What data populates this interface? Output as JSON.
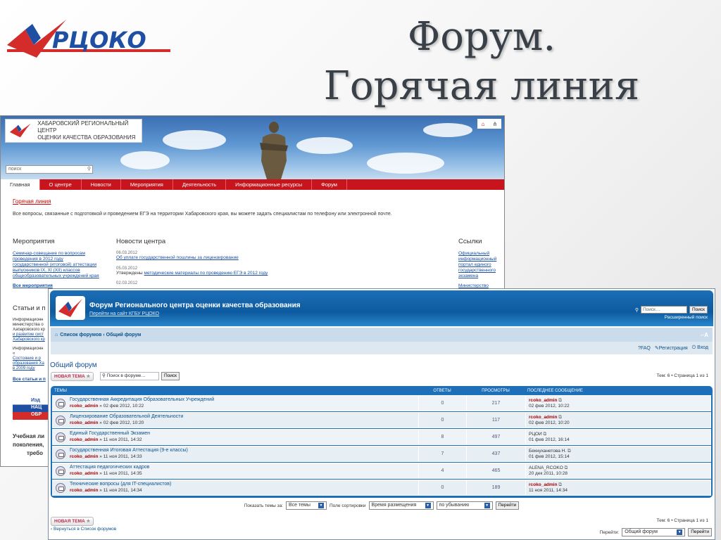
{
  "slide": {
    "title_line1": "Форум.",
    "title_line2": "Горячая линия",
    "logo_text": "РЦОКО",
    "brand_colors": {
      "red": "#d42b2b",
      "blue": "#1f4fa3"
    }
  },
  "site": {
    "logo_line1": "ХАБАРОВСКИЙ РЕГИОНАЛЬНЫЙ ЦЕНТР",
    "logo_line2": "ОЦЕНКИ КАЧЕСТВА ОБРАЗОВАНИЯ",
    "search_placeholder": "поиск",
    "nav": [
      "Главная",
      "О центре",
      "Новости",
      "Мероприятия",
      "Деятельность",
      "Информационные ресурсы",
      "Форум"
    ],
    "hotline_link": "Горячая линия",
    "intro": "Все вопросы, связанные с подготовкой и проведением ЕГЭ на территории Хабаровского края, вы можете задать специалистам по телефону или электронной почте.",
    "events": {
      "heading": "Мероприятия",
      "link_lines": [
        "Семинар-совещание по вопросам",
        "проведения в 2012 году",
        "государственной (итоговой) аттестации",
        "выпускников IX, XI (XII) классов",
        "общеобразовательных учреждений края"
      ],
      "all_link": "Все мероприятия"
    },
    "news": {
      "heading": "Новости центра",
      "items": [
        {
          "date": "06.03.2012",
          "text": "Об уплате государственной пошлины за лицензирование"
        },
        {
          "date": "05.03.2012",
          "prefix": "Утверждены ",
          "text": "методические материалы по проведению ЕГЭ в 2012 году"
        },
        {
          "date": "02.03.2012",
          "text": ""
        }
      ]
    },
    "links": {
      "heading": "Ссылки",
      "link_lines": [
        "Официальный",
        "информационный",
        "портал единого",
        "государственного",
        "экзамена"
      ],
      "next": "Министерство"
    },
    "articles": {
      "heading": "Статьи и п",
      "text1": [
        "Информационн",
        "министерства о",
        "Хабаровского кр"
      ],
      "links1": [
        "и развитие сист",
        "Хабаровского кр"
      ],
      "text2": [
        "Информационн",
        "«"
      ],
      "links2": [
        "Состояние и р",
        "образования Ха",
        "в 2009 году"
      ],
      "all": "Все статьи и п"
    },
    "ad": {
      "lines": [
        "Изд",
        "НАЦ",
        "ОБР"
      ],
      "caption": [
        "Учебная ли",
        "поколения,",
        "требо"
      ]
    }
  },
  "forum": {
    "title": "Форум Регионального центра оценки качества образования",
    "subtitle": "Перейти на сайт КГБУ РЦОКО",
    "search_placeholder": "Поиск…",
    "search_btn": "Поиск",
    "advanced_search": "Расширенный поиск",
    "breadcrumb_root": "Список форумов",
    "breadcrumb_sep": " ‹ ",
    "breadcrumb_current": "Общий форум",
    "fontsize": "-·A",
    "user_links": {
      "faq": "FAQ",
      "register": "Регистрация",
      "login": "Вход"
    },
    "heading": "Общий форум",
    "new_topic": "НОВАЯ ТЕМА",
    "forum_search_placeholder": "Поиск в форуме…",
    "forum_search_btn": "Поиск",
    "pagination": "Тем: 6 • Страница 1 из 1",
    "columns": {
      "topics": "ТЕМЫ",
      "replies": "ОТВЕТЫ",
      "views": "ПРОСМОТРЫ",
      "last": "ПОСЛЕДНЕЕ СООБЩЕНИЕ"
    },
    "topics": [
      {
        "title": "Государственная Аккредитация Образовательных Учреждений",
        "author": "rcoko_admin",
        "date": "» 02 фев 2012, 10:22",
        "replies": "0",
        "views": "217",
        "last_author": "rcoko_admin",
        "last_author_admin": true,
        "last_date": "02 фев 2012, 10:22"
      },
      {
        "title": "Лицензирование Образовательной Деятельности",
        "author": "rcoko_admin",
        "date": "» 02 фев 2012, 10:20",
        "replies": "0",
        "views": "117",
        "last_author": "rcoko_admin",
        "last_author_admin": true,
        "last_date": "02 фев 2012, 10:20"
      },
      {
        "title": "Единый Государственный Экзамен",
        "author": "rcoko_admin",
        "date": "» 11 ноя 2011, 14:32",
        "replies": "8",
        "views": "497",
        "last_author": "РЦОИ",
        "last_author_admin": false,
        "last_date": "01 фев 2012, 16:14"
      },
      {
        "title": "Государственная Итоговая Аттестация (9-е классы)",
        "author": "rcoko_admin",
        "date": "» 11 ноя 2011, 14:33",
        "replies": "7",
        "views": "437",
        "last_author": "Бекнуханетова Н.",
        "last_author_admin": false,
        "last_date": "01 фев 2012, 15:14"
      },
      {
        "title": "Аттестация педагогических кадров",
        "author": "rcoko_admin",
        "date": "» 11 ноя 2011, 14:35",
        "replies": "4",
        "views": "465",
        "last_author": "ALENA_RCOKO",
        "last_author_admin": false,
        "last_date": "20 дек 2011, 10:28"
      },
      {
        "title": "Технические вопросы (для IT-специалистов)",
        "author": "rcoko_admin",
        "date": "» 11 ноя 2011, 14:34",
        "replies": "0",
        "views": "189",
        "last_author": "rcoko_admin",
        "last_author_admin": true,
        "last_date": "11 ноя 2011, 14:34"
      }
    ],
    "sort": {
      "show_label": "Показать темы за:",
      "period": "Все темы",
      "sort_label": "Поле сортировки",
      "field": "Время размещения",
      "order": "по убыванию",
      "go": "Перейти"
    },
    "back": "Вернуться в Список форумов",
    "jump_label": "Перейти:",
    "jump_value": "Общий форум",
    "jump_btn": "Перейти"
  }
}
